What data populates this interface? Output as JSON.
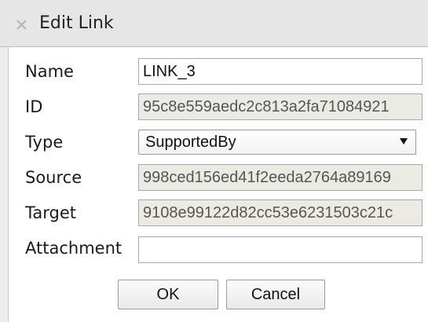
{
  "dialog": {
    "title": "Edit Link"
  },
  "fields": {
    "name": {
      "label": "Name",
      "value": "LINK_3"
    },
    "id": {
      "label": "ID",
      "value": "95c8e559aedc2c813a2fa71084921"
    },
    "type": {
      "label": "Type",
      "value": "SupportedBy"
    },
    "source": {
      "label": "Source",
      "value": "998ced156ed41f2eeda2764a89169"
    },
    "target": {
      "label": "Target",
      "value": "9108e99122d82cc53e6231503c21c"
    },
    "attachment": {
      "label": "Attachment",
      "value": ""
    }
  },
  "buttons": {
    "ok": "OK",
    "cancel": "Cancel"
  },
  "icons": {
    "close": "close-icon",
    "dropdown": "chevron-down-icon"
  }
}
